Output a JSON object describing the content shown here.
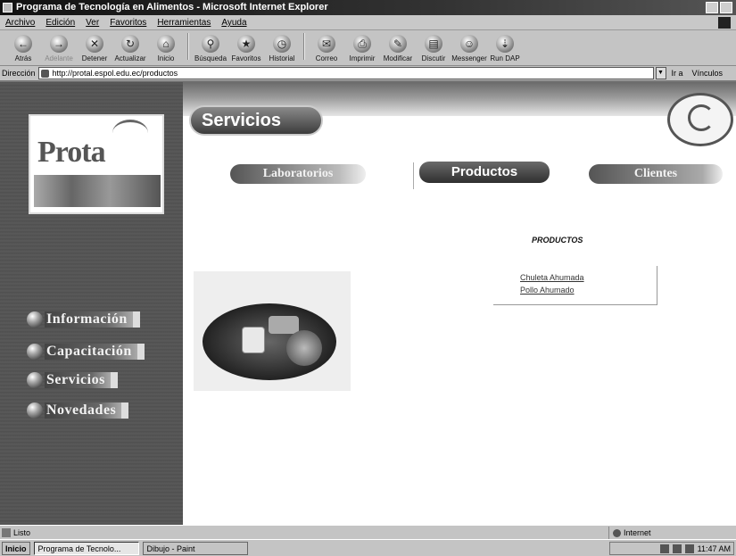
{
  "window": {
    "title": "Programa de Tecnología en Alimentos - Microsoft Internet Explorer"
  },
  "menu": {
    "items": [
      "Archivo",
      "Edición",
      "Ver",
      "Favoritos",
      "Herramientas",
      "Ayuda"
    ]
  },
  "toolbar": {
    "buttons": [
      {
        "label": "Atrás",
        "icon": "back-arrow-icon"
      },
      {
        "label": "Adelante",
        "icon": "forward-arrow-icon"
      },
      {
        "label": "Detener",
        "icon": "stop-icon"
      },
      {
        "label": "Actualizar",
        "icon": "refresh-icon"
      },
      {
        "label": "Inicio",
        "icon": "home-icon"
      },
      {
        "label": "Búsqueda",
        "icon": "search-icon"
      },
      {
        "label": "Favoritos",
        "icon": "favorites-icon"
      },
      {
        "label": "Historial",
        "icon": "history-icon"
      },
      {
        "label": "Correo",
        "icon": "mail-icon"
      },
      {
        "label": "Imprimir",
        "icon": "print-icon"
      },
      {
        "label": "Modificar",
        "icon": "edit-icon"
      },
      {
        "label": "Discutir",
        "icon": "discuss-icon"
      },
      {
        "label": "Messenger",
        "icon": "messenger-icon"
      },
      {
        "label": "Run DAP",
        "icon": "dap-icon"
      }
    ]
  },
  "address": {
    "label": "Dirección",
    "url": "http://protal.espol.edu.ec/productos",
    "go_label": "Ir a",
    "links_label": "Vínculos"
  },
  "page": {
    "logo_text": "Prota",
    "section_title": "Servicios",
    "top_tabs": {
      "laboratorios": "Laboratorios",
      "productos": "Productos",
      "clientes": "Clientes"
    },
    "products_heading": "PRODUCTOS",
    "product_links": [
      "Chuleta Ahumada",
      "Pollo Ahumado"
    ],
    "side_nav": [
      "Información",
      "Capacitación",
      "Servicios",
      "Novedades"
    ]
  },
  "status": {
    "text": "Listo",
    "zone": "Internet"
  },
  "taskbar": {
    "start": "Inicio",
    "tasks": [
      "Programa de Tecnolo...",
      "Dibujo - Paint"
    ],
    "clock": "11:47 AM"
  }
}
